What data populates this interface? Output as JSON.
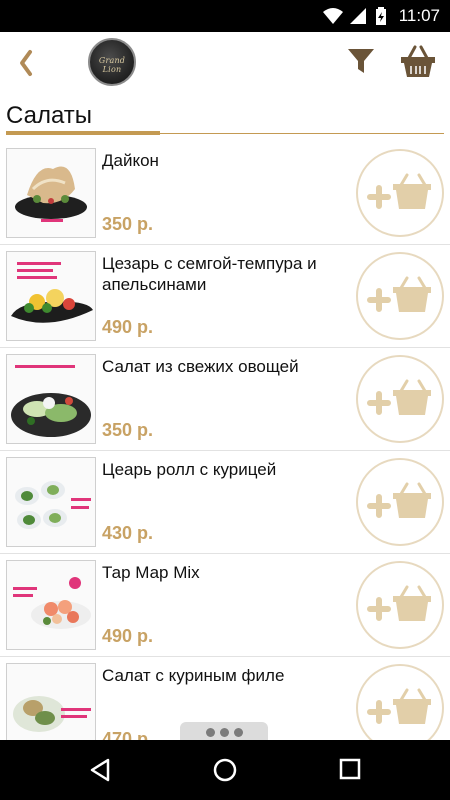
{
  "status_bar": {
    "time": "11:07"
  },
  "header": {
    "logo_text": "Grand Lion",
    "back_icon": "chevron-left-icon",
    "filter_icon": "funnel-icon",
    "cart_icon": "basket-icon"
  },
  "section": {
    "title": "Салаты"
  },
  "products": [
    {
      "name": "Дайкон",
      "price": "350 р."
    },
    {
      "name": "Цезарь с семгой-темпура и апельсинами",
      "price": "490 р."
    },
    {
      "name": "Салат из свежих овощей",
      "price": "350 р."
    },
    {
      "name": "Цеарь ролл с курицей",
      "price": "430 р."
    },
    {
      "name": "Тар Мар Mix",
      "price": "490 р."
    },
    {
      "name": "Салат с куриным филе",
      "price": "470 р."
    }
  ],
  "colors": {
    "accent": "#c49a52",
    "price": "#c8a264",
    "add_button": "#e7d9bf"
  }
}
